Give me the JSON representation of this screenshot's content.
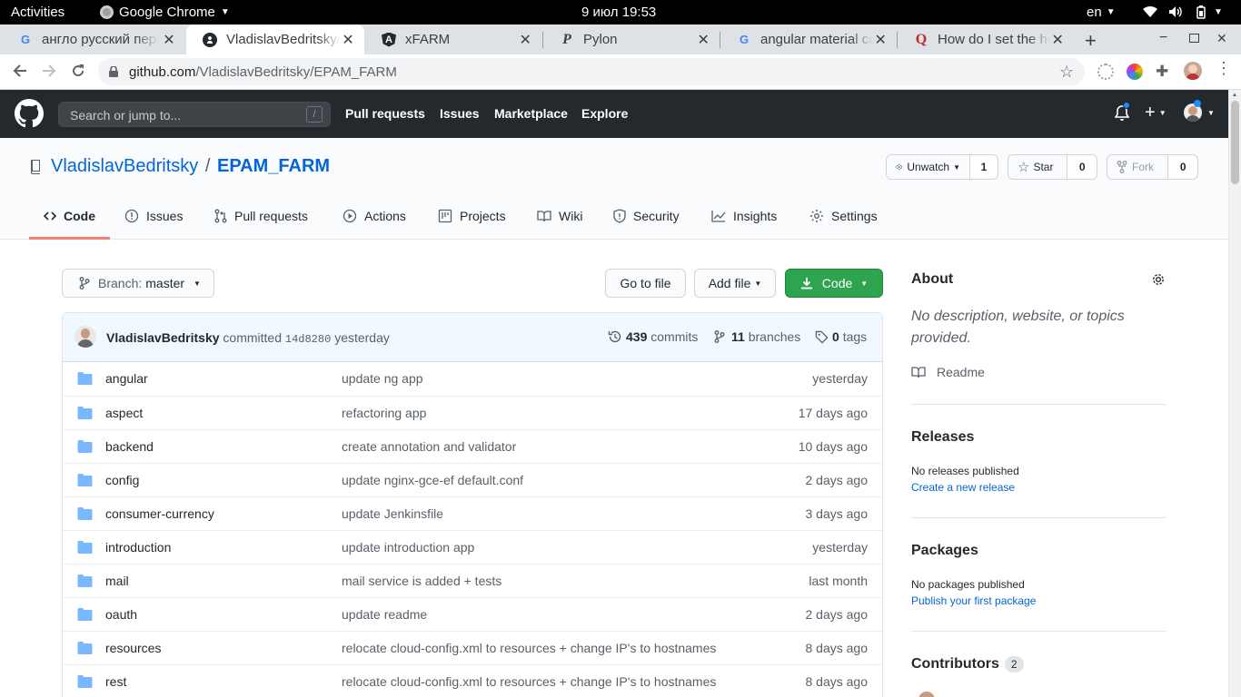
{
  "gnome": {
    "activities": "Activities",
    "app": "Google Chrome",
    "datetime": "9 июл  19:53",
    "lang": "en"
  },
  "tabs": [
    {
      "title": "англо русский пере",
      "favicon": "google-icon"
    },
    {
      "title": "VladislavBedritsky/",
      "favicon": "github-icon"
    },
    {
      "title": "xFARM",
      "favicon": "angular-icon"
    },
    {
      "title": "Pylon",
      "favicon": "pylon-icon"
    },
    {
      "title": "angular material ca",
      "favicon": "google-icon"
    },
    {
      "title": "How do I set the he",
      "favicon": "quora-icon"
    }
  ],
  "browser": {
    "url_host": "github.com",
    "url_path": "/VladislavBedritsky/EPAM_FARM"
  },
  "gh_header": {
    "search_placeholder": "Search or jump to...",
    "search_key": "/",
    "nav": [
      "Pull requests",
      "Issues",
      "Marketplace",
      "Explore"
    ]
  },
  "repo": {
    "owner": "VladislavBedritsky",
    "sep": "/",
    "name": "EPAM_FARM",
    "watch_label": "Unwatch",
    "watch_count": "1",
    "star_label": "Star",
    "star_count": "0",
    "fork_label": "Fork",
    "fork_count": "0",
    "tabs": [
      "Code",
      "Issues",
      "Pull requests",
      "Actions",
      "Projects",
      "Wiki",
      "Security",
      "Insights",
      "Settings"
    ]
  },
  "toolbar": {
    "branch_prefix": "Branch:",
    "branch": "master",
    "goto": "Go to file",
    "addfile": "Add file",
    "code": "Code"
  },
  "commit": {
    "author": "VladislavBedritsky",
    "verb": "committed",
    "sha": "14d8280",
    "when": "yesterday",
    "commits_count": "439",
    "commits_label": "commits",
    "branches_count": "11",
    "branches_label": "branches",
    "tags_count": "0",
    "tags_label": "tags"
  },
  "files": [
    {
      "name": "angular",
      "msg": "update ng app",
      "age": "yesterday"
    },
    {
      "name": "aspect",
      "msg": "refactoring app",
      "age": "17 days ago"
    },
    {
      "name": "backend",
      "msg": "create annotation and validator",
      "age": "10 days ago"
    },
    {
      "name": "config",
      "msg": "update nginx-gce-ef default.conf",
      "age": "2 days ago"
    },
    {
      "name": "consumer-currency",
      "msg": "update Jenkinsfile",
      "age": "3 days ago"
    },
    {
      "name": "introduction",
      "msg": "update introduction app",
      "age": "yesterday"
    },
    {
      "name": "mail",
      "msg": "mail service is added + tests",
      "age": "last month"
    },
    {
      "name": "oauth",
      "msg": "update readme",
      "age": "2 days ago"
    },
    {
      "name": "resources",
      "msg": "relocate cloud-config.xml to resources + change IP's to hostnames",
      "age": "8 days ago"
    },
    {
      "name": "rest",
      "msg": "relocate cloud-config.xml to resources + change IP's to hostnames",
      "age": "8 days ago"
    }
  ],
  "sidebar": {
    "about": "About",
    "about_desc": "No description, website, or topics provided.",
    "readme": "Readme",
    "releases": "Releases",
    "releases_none": "No releases published",
    "releases_link": "Create a new release",
    "packages": "Packages",
    "packages_none": "No packages published",
    "packages_link": "Publish your first package",
    "contributors": "Contributors",
    "contributors_count": "2"
  },
  "colors": {
    "gh_dark": "#24292e",
    "link": "#0366d6",
    "green": "#2ea44f",
    "accent_tab": "#f9826c",
    "folder": "#79b8ff"
  }
}
